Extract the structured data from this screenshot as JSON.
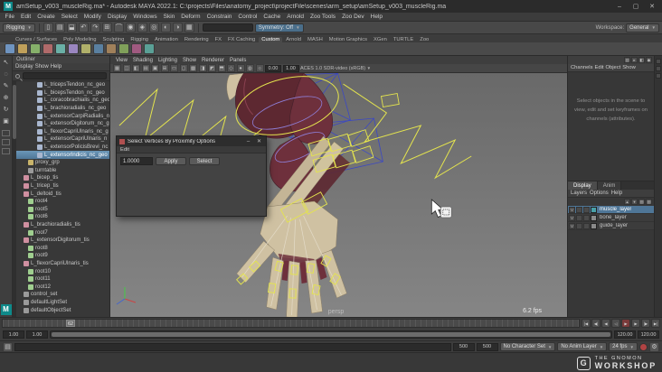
{
  "titlebar": {
    "icon": "M",
    "title": "amSetup_v003_muscleRig.ma* - Autodesk MAYA 2022.1: C:\\projects\\Files\\anatomy_project\\projectFile\\scenes\\arm_setup\\amSetup_v003_muscleRig.ma",
    "minimize": "–",
    "maximize": "▢",
    "close": "✕"
  },
  "menubar": {
    "menus": [
      "File",
      "Edit",
      "Create",
      "Select",
      "Modify",
      "Display",
      "Windows",
      "Skin",
      "Deform",
      "Constrain",
      "Control",
      "Cache",
      "Arnold",
      "Zoo Tools",
      "Zoo Dev",
      "Help"
    ]
  },
  "statusline": {
    "menuset": "Rigging",
    "icons": [
      {
        "n": "new-scene-icon",
        "g": "▯"
      },
      {
        "n": "open-scene-icon",
        "g": "▤"
      },
      {
        "n": "save-scene-icon",
        "g": "⬓"
      },
      {
        "n": "undo-icon",
        "g": "↶"
      },
      {
        "n": "redo-icon",
        "g": "↷"
      },
      {
        "n": "snap-grid-icon",
        "g": "⊞"
      },
      {
        "n": "snap-curve-icon",
        "g": "⌒"
      },
      {
        "n": "snap-point-icon",
        "g": "◉"
      },
      {
        "n": "snap-plane-icon",
        "g": "◈"
      },
      {
        "n": "make-live-icon",
        "g": "◎"
      },
      {
        "n": "render-icon",
        "g": "◐"
      },
      {
        "n": "ipr-render-icon",
        "g": "◑"
      },
      {
        "n": "render-settings-icon",
        "g": "▦"
      }
    ],
    "symmetry": "Symmetry: Off",
    "workspace_label": "Workspace:",
    "workspace": "General"
  },
  "shelf": {
    "tabs": [
      {
        "label": "Curves / Surfaces",
        "cls": ""
      },
      {
        "label": "Poly Modeling",
        "cls": ""
      },
      {
        "label": "Sculpting",
        "cls": ""
      },
      {
        "label": "Rigging",
        "cls": ""
      },
      {
        "label": "Animation",
        "cls": ""
      },
      {
        "label": "Rendering",
        "cls": ""
      },
      {
        "label": "FX",
        "cls": ""
      },
      {
        "label": "FX Caching",
        "cls": ""
      },
      {
        "label": "Custom",
        "cls": "active"
      },
      {
        "label": "Arnold",
        "cls": ""
      },
      {
        "label": "MASH",
        "cls": ""
      },
      {
        "label": "Motion Graphics",
        "cls": ""
      },
      {
        "label": "XGen",
        "cls": ""
      },
      {
        "label": "TURTLE",
        "cls": ""
      },
      {
        "label": "Zoo",
        "cls": ""
      }
    ],
    "icons": [
      {
        "n": "shelf-tool-1",
        "c": "#6f94c0"
      },
      {
        "n": "shelf-tool-2",
        "c": "#c0a05a"
      },
      {
        "n": "shelf-tool-3",
        "c": "#86b06a"
      },
      {
        "n": "shelf-tool-4",
        "c": "#b06a6a"
      },
      {
        "n": "shelf-tool-5",
        "c": "#6ab0a6"
      },
      {
        "n": "shelf-tool-6",
        "c": "#9a86c0"
      },
      {
        "n": "shelf-tool-7",
        "c": "#b0b06a"
      },
      {
        "n": "shelf-tool-8",
        "c": "#5a80a0"
      },
      {
        "n": "shelf-tool-9",
        "c": "#a0805a"
      },
      {
        "n": "shelf-tool-10",
        "c": "#80a05a"
      },
      {
        "n": "shelf-tool-11",
        "c": "#a05a80"
      },
      {
        "n": "shelf-tool-12",
        "c": "#5aa096"
      }
    ]
  },
  "toolbox": {
    "tools": [
      {
        "n": "select-tool",
        "g": "↖"
      },
      {
        "n": "lasso-tool",
        "g": "◌"
      },
      {
        "n": "paint-select-tool",
        "g": "✎"
      },
      {
        "n": "move-tool",
        "g": "⊕"
      },
      {
        "n": "rotate-tool",
        "g": "↻"
      },
      {
        "n": "scale-tool",
        "g": "▣"
      }
    ]
  },
  "outliner": {
    "title": "Outliner",
    "menus": [
      "Display",
      "Show",
      "Help"
    ],
    "items": [
      {
        "name": "L_tricepsTendon_nc_geo",
        "depth": 4,
        "color": "#a9b7cf",
        "cls": ""
      },
      {
        "name": "L_bicepsTendon_nc_geo",
        "depth": 4,
        "color": "#a9b7cf",
        "cls": ""
      },
      {
        "name": "L_coracobrachialis_nc_geo",
        "depth": 4,
        "color": "#a9b7cf",
        "cls": ""
      },
      {
        "name": "L_brachioradialis_nc_geo",
        "depth": 4,
        "color": "#a9b7cf",
        "cls": ""
      },
      {
        "name": "L_extensorCarpiRadialis_n",
        "depth": 4,
        "color": "#a9b7cf",
        "cls": ""
      },
      {
        "name": "L_extensorDigitorum_nc_g",
        "depth": 4,
        "color": "#a9b7cf",
        "cls": ""
      },
      {
        "name": "L_flexorCapriUlnaris_nc_g",
        "depth": 4,
        "color": "#a9b7cf",
        "cls": ""
      },
      {
        "name": "L_extensorCapriUlnaris_n",
        "depth": 4,
        "color": "#a9b7cf",
        "cls": ""
      },
      {
        "name": "L_extensorPolicisBrevi_nc",
        "depth": 4,
        "color": "#a9b7cf",
        "cls": ""
      },
      {
        "name": "L_extensorIndicis_nc_geo",
        "depth": 4,
        "color": "#a9b7cf",
        "cls": "sel"
      },
      {
        "name": "proxy_grp",
        "depth": 2,
        "color": "#c9b46a",
        "cls": ""
      },
      {
        "name": "turntable",
        "depth": 2,
        "color": "#9a9a9a",
        "cls": ""
      },
      {
        "name": "L_bicep_tis",
        "depth": 1,
        "color": "#cf8fa0",
        "cls": ""
      },
      {
        "name": "L_tricep_tis",
        "depth": 1,
        "color": "#cf8fa0",
        "cls": ""
      },
      {
        "name": "L_deltoid_tis",
        "depth": 1,
        "color": "#cf8fa0",
        "cls": ""
      },
      {
        "name": "root4",
        "depth": 2,
        "color": "#9fcf8f",
        "cls": ""
      },
      {
        "name": "root5",
        "depth": 2,
        "color": "#9fcf8f",
        "cls": ""
      },
      {
        "name": "root6",
        "depth": 2,
        "color": "#9fcf8f",
        "cls": ""
      },
      {
        "name": "L_brachioradialis_tis",
        "depth": 1,
        "color": "#cf8fa0",
        "cls": ""
      },
      {
        "name": "root7",
        "depth": 2,
        "color": "#9fcf8f",
        "cls": ""
      },
      {
        "name": "L_extensorDigitorum_tis",
        "depth": 1,
        "color": "#cf8fa0",
        "cls": ""
      },
      {
        "name": "root8",
        "depth": 2,
        "color": "#9fcf8f",
        "cls": ""
      },
      {
        "name": "root9",
        "depth": 2,
        "color": "#9fcf8f",
        "cls": ""
      },
      {
        "name": "L_flexorCapriUlnaris_tis",
        "depth": 1,
        "color": "#cf8fa0",
        "cls": ""
      },
      {
        "name": "root10",
        "depth": 2,
        "color": "#9fcf8f",
        "cls": ""
      },
      {
        "name": "root11",
        "depth": 2,
        "color": "#9fcf8f",
        "cls": ""
      },
      {
        "name": "root12",
        "depth": 2,
        "color": "#9fcf8f",
        "cls": ""
      },
      {
        "name": "control_set",
        "depth": 1,
        "color": "#9a9a9a",
        "cls": ""
      },
      {
        "name": "defaultLightSet",
        "depth": 1,
        "color": "#9a9a9a",
        "cls": ""
      },
      {
        "name": "defaultObjectSet",
        "depth": 1,
        "color": "#9a9a9a",
        "cls": ""
      }
    ]
  },
  "viewport": {
    "menus": [
      "View",
      "Shading",
      "Lighting",
      "Show",
      "Renderer",
      "Panels"
    ],
    "toolbar_icons": [
      {
        "n": "camera-select-icon",
        "g": "▦"
      },
      {
        "n": "lock-camera-icon",
        "g": "◫"
      },
      {
        "n": "camera-attrs-icon",
        "g": "◧"
      },
      {
        "n": "bookmark-icon",
        "g": "▤"
      },
      {
        "n": "image-plane-icon",
        "g": "▣"
      },
      {
        "n": "view-grid-icon",
        "g": "⊞"
      },
      {
        "n": "film-gate-icon",
        "g": "▭"
      },
      {
        "n": "resolution-gate-icon",
        "g": "◻"
      },
      {
        "n": "gate-mask-icon",
        "g": "▩"
      },
      {
        "n": "field-chart-icon",
        "g": "◨"
      },
      {
        "n": "safe-action-icon",
        "g": "◩"
      },
      {
        "n": "safe-title-icon",
        "g": "⬒"
      },
      {
        "n": "wireframe-icon",
        "g": "◇"
      },
      {
        "n": "shaded-icon",
        "g": "●"
      },
      {
        "n": "textured-icon",
        "g": "◍"
      },
      {
        "n": "lighting-icon",
        "g": "☼"
      }
    ],
    "exposure": "0.00",
    "gamma": "1.00",
    "colorspace": "ACES 1.0 SDR-video (sRGB)",
    "camera_label": "persp",
    "fps": "6.2 fps"
  },
  "dialog": {
    "title": "Select Vertices By Proximity Options",
    "menus": [
      "Edit"
    ],
    "radius_value": "1.0000",
    "apply": "Apply",
    "select": "Select",
    "minimize": "–",
    "close": "✕"
  },
  "channel_box": {
    "menus": [
      "Channels",
      "Edit",
      "Object",
      "Show"
    ],
    "icons": [
      {
        "n": "channel-display-icon",
        "g": "▤"
      },
      {
        "n": "channel-speed-icon",
        "g": "▸"
      },
      {
        "n": "channel-hyper-icon",
        "g": "◧"
      },
      {
        "n": "channel-key-icon",
        "g": "◆"
      }
    ],
    "empty_message": "Select objects in the scene to view, edit and set keyframes on channels (attributes)."
  },
  "layer_editor": {
    "tabs": [
      {
        "label": "Display",
        "cls": "active"
      },
      {
        "label": "Anim",
        "cls": ""
      }
    ],
    "menus": [
      "Layers",
      "Options",
      "Help"
    ],
    "toolbar_icons": [
      {
        "n": "move-layer-up-icon",
        "g": "▴"
      },
      {
        "n": "move-layer-down-icon",
        "g": "▾"
      },
      {
        "n": "new-empty-layer-icon",
        "g": "▧"
      },
      {
        "n": "new-layer-from-selected-icon",
        "g": "▨"
      }
    ],
    "layers": [
      {
        "name": "muscle_layer",
        "cls": "sel",
        "swatch": "#49a0a8",
        "vis": "V"
      },
      {
        "name": "bone_layer",
        "cls": "",
        "swatch": "#8a8a8a",
        "vis": "V"
      },
      {
        "name": "guide_layer",
        "cls": "",
        "swatch": "#8a8a8a",
        "vis": "V"
      }
    ]
  },
  "rightstrip": {
    "icons": [
      {
        "n": "channel-box-tab-icon"
      },
      {
        "n": "attribute-editor-tab-icon"
      },
      {
        "n": "tool-settings-tab-icon"
      }
    ]
  },
  "timeline": {
    "current_frame": "62"
  },
  "playback": {
    "buttons": [
      {
        "n": "go-to-start-button",
        "g": "|◀",
        "cls": ""
      },
      {
        "n": "step-back-key-button",
        "g": "◀|",
        "cls": ""
      },
      {
        "n": "step-back-frame-button",
        "g": "◀",
        "cls": ""
      },
      {
        "n": "play-backwards-button",
        "g": "◁",
        "cls": ""
      },
      {
        "n": "play-forward-button",
        "g": "▶",
        "cls": "red"
      },
      {
        "n": "step-forward-frame-button",
        "g": "▶",
        "cls": ""
      },
      {
        "n": "step-forward-key-button",
        "g": "|▶",
        "cls": ""
      },
      {
        "n": "go-to-end-button",
        "g": "▶|",
        "cls": ""
      }
    ]
  },
  "range_slider": {
    "anim_start": "1.00",
    "play_start": "1.00",
    "play_end": "120.00",
    "anim_end": "120.00"
  },
  "status_bar": {
    "field_a": "500",
    "field_b": "500",
    "character_set": "No Character Set",
    "anim_layer": "No Anim Layer",
    "fps": "24 fps"
  },
  "watermark": {
    "logo": "G",
    "line1": "THE GNOMON",
    "line2": "WORKSHOP"
  }
}
